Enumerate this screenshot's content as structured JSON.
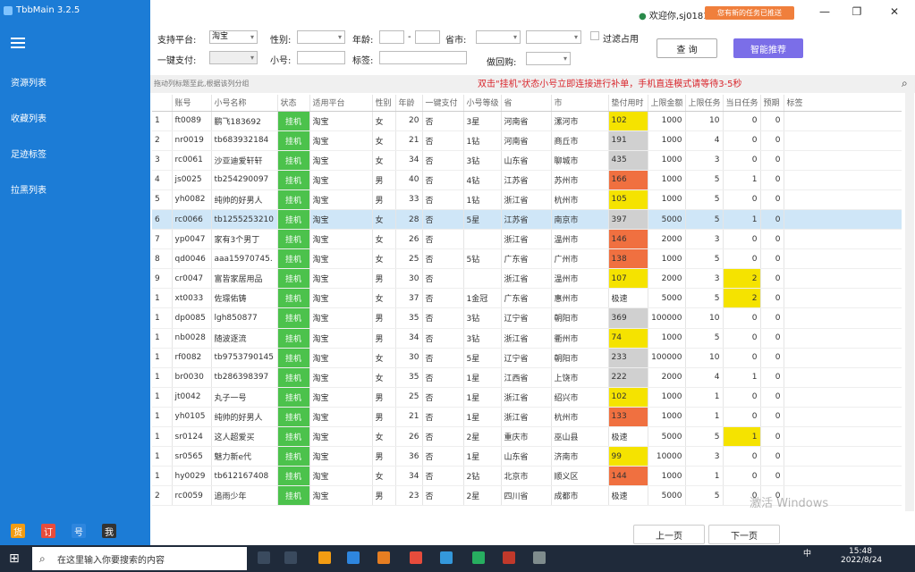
{
  "app": {
    "title": "TbbMain  3.2.5",
    "user": "欢迎你,sj0181",
    "notice": "您有新的任务已推送"
  },
  "sidebar": {
    "items": [
      "资源列表",
      "收藏列表",
      "足迹标签",
      "拉黑列表"
    ],
    "bottom": [
      {
        "label": "货",
        "color": "#f39c12"
      },
      {
        "label": "订",
        "color": "#e74c3c"
      },
      {
        "label": "号",
        "color": "#2e86de"
      },
      {
        "label": "我",
        "color": "#333333"
      }
    ]
  },
  "filters": {
    "platform_label": "支持平台:",
    "platform_value": "淘宝",
    "gender_label": "性别:",
    "age_label": "年龄:",
    "province_label": "省市:",
    "pay_label": "一键支付:",
    "account_label": "小号:",
    "tag_label": "标签:",
    "fake_label": "做回购:",
    "filter_label": "过滤占用",
    "query": "查  询",
    "smart": "智能推荐"
  },
  "hint": {
    "left": "拖动列标题至此,根据该列分组",
    "right": "双击\"挂机\"状态小号立即连接进行补单，手机直连模式请等待3-5秒"
  },
  "table": {
    "headers": [
      "",
      "账号",
      "小号名称",
      "状态",
      "适用平台",
      "性别",
      "年龄",
      "一键支付",
      "小号等级",
      "省",
      "市",
      "垫付用时",
      "上限金额",
      "上限任务",
      "当日任务",
      "预期",
      "标签"
    ],
    "rows": [
      [
        "1",
        "ft0089",
        "鹏飞183692",
        "挂机",
        "淘宝",
        "女",
        "20",
        "否",
        "3星",
        "河南省",
        "漯河市",
        "102",
        "1000",
        "10",
        "0",
        "0",
        ""
      ],
      [
        "2",
        "nr0019",
        "tb683932184",
        "挂机",
        "淘宝",
        "女",
        "21",
        "否",
        "1钻",
        "河南省",
        "商丘市",
        "191",
        "1000",
        "4",
        "0",
        "0",
        ""
      ],
      [
        "3",
        "rc0061",
        "沙亚迪爱轩轩",
        "挂机",
        "淘宝",
        "女",
        "34",
        "否",
        "3钻",
        "山东省",
        "聊城市",
        "435",
        "1000",
        "3",
        "0",
        "0",
        ""
      ],
      [
        "4",
        "js0025",
        "tb254290097",
        "挂机",
        "淘宝",
        "男",
        "40",
        "否",
        "4钻",
        "江苏省",
        "苏州市",
        "166",
        "1000",
        "5",
        "1",
        "0",
        ""
      ],
      [
        "5",
        "yh0082",
        "纯帅的好男人",
        "挂机",
        "淘宝",
        "男",
        "33",
        "否",
        "1钻",
        "浙江省",
        "杭州市",
        "105",
        "1000",
        "5",
        "0",
        "0",
        ""
      ],
      [
        "6",
        "rc0066",
        "tb1255253210",
        "挂机",
        "淘宝",
        "女",
        "28",
        "否",
        "5星",
        "江苏省",
        "南京市",
        "397",
        "5000",
        "5",
        "1",
        "0",
        ""
      ],
      [
        "7",
        "yp0047",
        "家有3个男丁",
        "挂机",
        "淘宝",
        "女",
        "26",
        "否",
        "",
        "浙江省",
        "温州市",
        "146",
        "2000",
        "3",
        "0",
        "0",
        ""
      ],
      [
        "8",
        "qd0046",
        "aaa15970745.",
        "挂机",
        "淘宝",
        "女",
        "25",
        "否",
        "5钻",
        "广东省",
        "广州市",
        "138",
        "1000",
        "5",
        "0",
        "0",
        ""
      ],
      [
        "9",
        "cr0047",
        "富皆家居用品",
        "挂机",
        "淘宝",
        "男",
        "30",
        "否",
        "",
        "浙江省",
        "温州市",
        "107",
        "2000",
        "3",
        "2",
        "0",
        ""
      ],
      [
        "1",
        "xt0033",
        "佐璟佑铸",
        "挂机",
        "淘宝",
        "女",
        "37",
        "否",
        "1金冠",
        "广东省",
        "惠州市",
        "极速",
        "5000",
        "5",
        "2",
        "0",
        ""
      ],
      [
        "1",
        "dp0085",
        "lgh850877",
        "挂机",
        "淘宝",
        "男",
        "35",
        "否",
        "3钻",
        "辽宁省",
        "朝阳市",
        "369",
        "100000",
        "10",
        "0",
        "0",
        ""
      ],
      [
        "1",
        "nb0028",
        "随波逐流",
        "挂机",
        "淘宝",
        "男",
        "34",
        "否",
        "3钻",
        "浙江省",
        "衢州市",
        "74",
        "1000",
        "5",
        "0",
        "0",
        ""
      ],
      [
        "1",
        "rf0082",
        "tb9753790145",
        "挂机",
        "淘宝",
        "女",
        "30",
        "否",
        "5星",
        "辽宁省",
        "朝阳市",
        "233",
        "100000",
        "10",
        "0",
        "0",
        ""
      ],
      [
        "1",
        "br0030",
        "tb286398397",
        "挂机",
        "淘宝",
        "女",
        "35",
        "否",
        "1星",
        "江西省",
        "上饶市",
        "222",
        "2000",
        "4",
        "1",
        "0",
        ""
      ],
      [
        "1",
        "jt0042",
        "丸子一号",
        "挂机",
        "淘宝",
        "男",
        "25",
        "否",
        "1星",
        "浙江省",
        "绍兴市",
        "102",
        "1000",
        "1",
        "0",
        "0",
        ""
      ],
      [
        "1",
        "yh0105",
        "纯帅的好男人",
        "挂机",
        "淘宝",
        "男",
        "21",
        "否",
        "1星",
        "浙江省",
        "杭州市",
        "133",
        "1000",
        "1",
        "0",
        "0",
        ""
      ],
      [
        "1",
        "sr0124",
        "这人超爱买",
        "挂机",
        "淘宝",
        "女",
        "26",
        "否",
        "2星",
        "重庆市",
        "巫山县",
        "极速",
        "5000",
        "5",
        "1",
        "0",
        ""
      ],
      [
        "1",
        "sr0565",
        "魅力新e代",
        "挂机",
        "淘宝",
        "男",
        "36",
        "否",
        "1星",
        "山东省",
        "济南市",
        "99",
        "10000",
        "3",
        "0",
        "0",
        ""
      ],
      [
        "1",
        "hy0029",
        "tb612167408",
        "挂机",
        "淘宝",
        "女",
        "34",
        "否",
        "2钻",
        "北京市",
        "顺义区",
        "144",
        "1000",
        "1",
        "0",
        "0",
        ""
      ],
      [
        "2",
        "rc0059",
        "追雨少年",
        "挂机",
        "淘宝",
        "男",
        "23",
        "否",
        "2星",
        "四川省",
        "成都市",
        "极速",
        "5000",
        "5",
        "0",
        "0",
        ""
      ]
    ],
    "pay_colors": [
      "#f5e300",
      "#d0d0d0",
      "#d0d0d0",
      "#f07040",
      "#f5e300",
      "#d0d0d0",
      "#f07040",
      "#f07040",
      "#f5e300",
      "",
      "#d0d0d0",
      "#f5e300",
      "#d0d0d0",
      "#d0d0d0",
      "#f5e300",
      "#f07040",
      "",
      "#f5e300",
      "#f07040",
      ""
    ],
    "today_colors": [
      "",
      "",
      "",
      "",
      "",
      "",
      "",
      "",
      "#f5e300",
      "#f5e300",
      "",
      "",
      "",
      "",
      "",
      "",
      "#f5e300",
      "",
      "",
      ""
    ],
    "selected_row": 5
  },
  "pager": {
    "prev": "上一页",
    "next": "下一页"
  },
  "taskbar": {
    "search_placeholder": "在这里输入你要搜索的内容",
    "time": "15:48",
    "date": "2022/8/24",
    "ime": "中"
  },
  "watermark": "激活 Windows"
}
